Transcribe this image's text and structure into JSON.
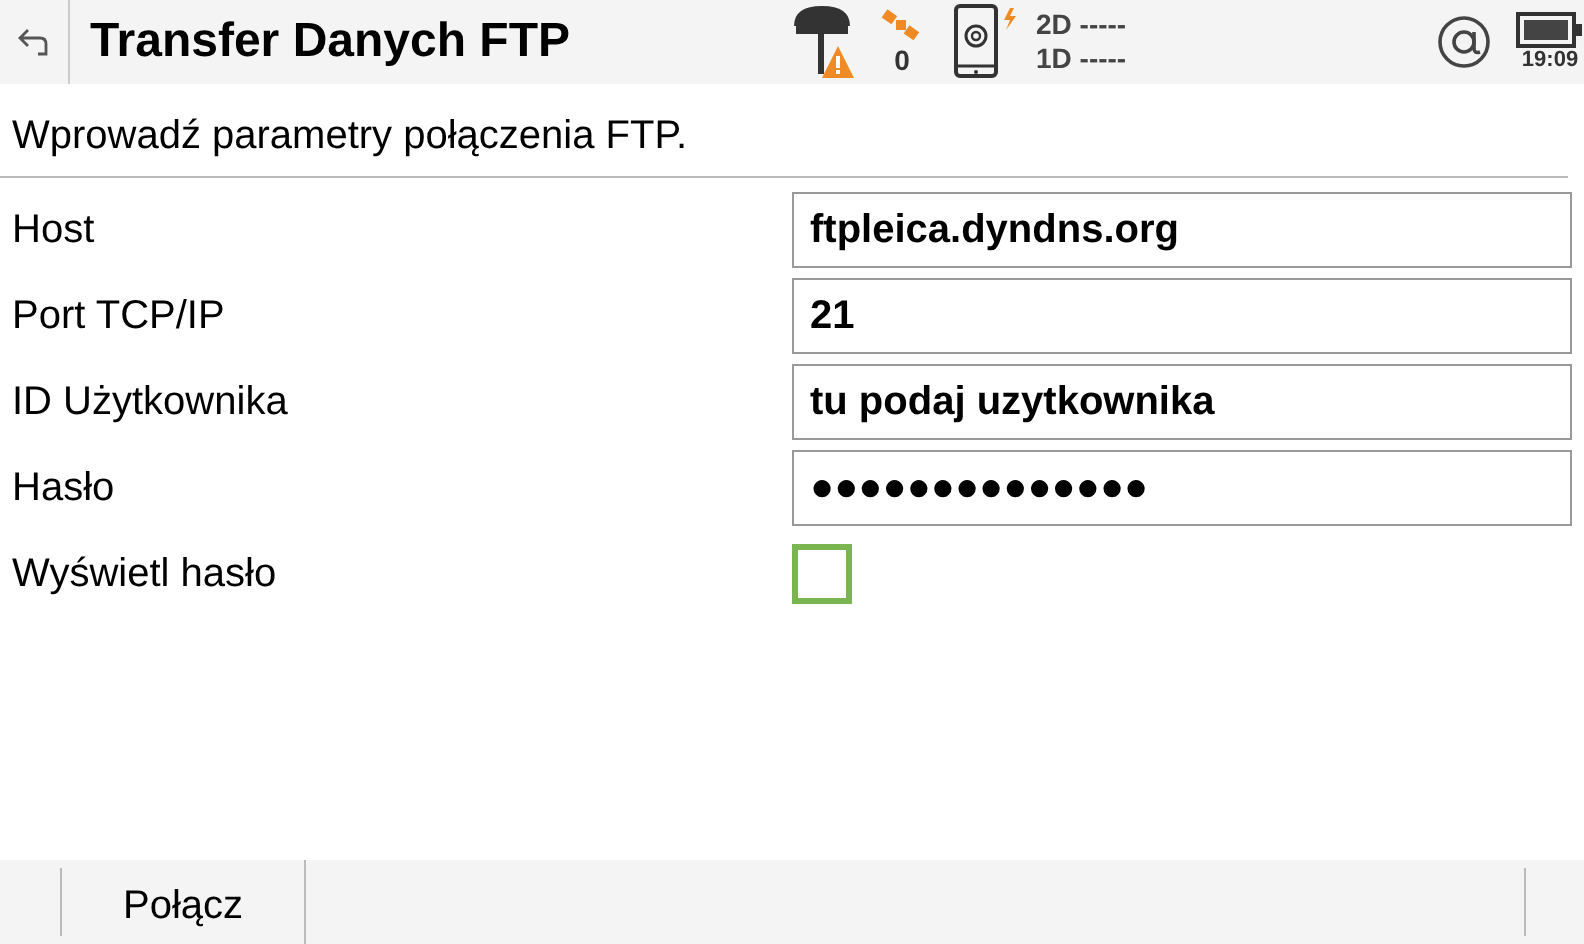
{
  "window": {
    "title": "Transfer Danych FTP"
  },
  "status": {
    "satellites": "0",
    "line_2d": "2D -----",
    "line_1d": "1D -----",
    "time": "19:09"
  },
  "instruction": "Wprowadź parametry połączenia FTP.",
  "fields": [
    {
      "label": "Host",
      "value": "ftpleica.dyndns.org"
    },
    {
      "label": "Port TCP/IP",
      "value": "21"
    },
    {
      "label": "ID Użytkownika",
      "value": "tu podaj uzytkownika"
    },
    {
      "label": "Hasło",
      "value": "●●●●●●●●●●●●●●"
    }
  ],
  "show_password": {
    "label": "Wyświetl hasło",
    "checked": false
  },
  "softkeys": [
    "Połącz"
  ]
}
